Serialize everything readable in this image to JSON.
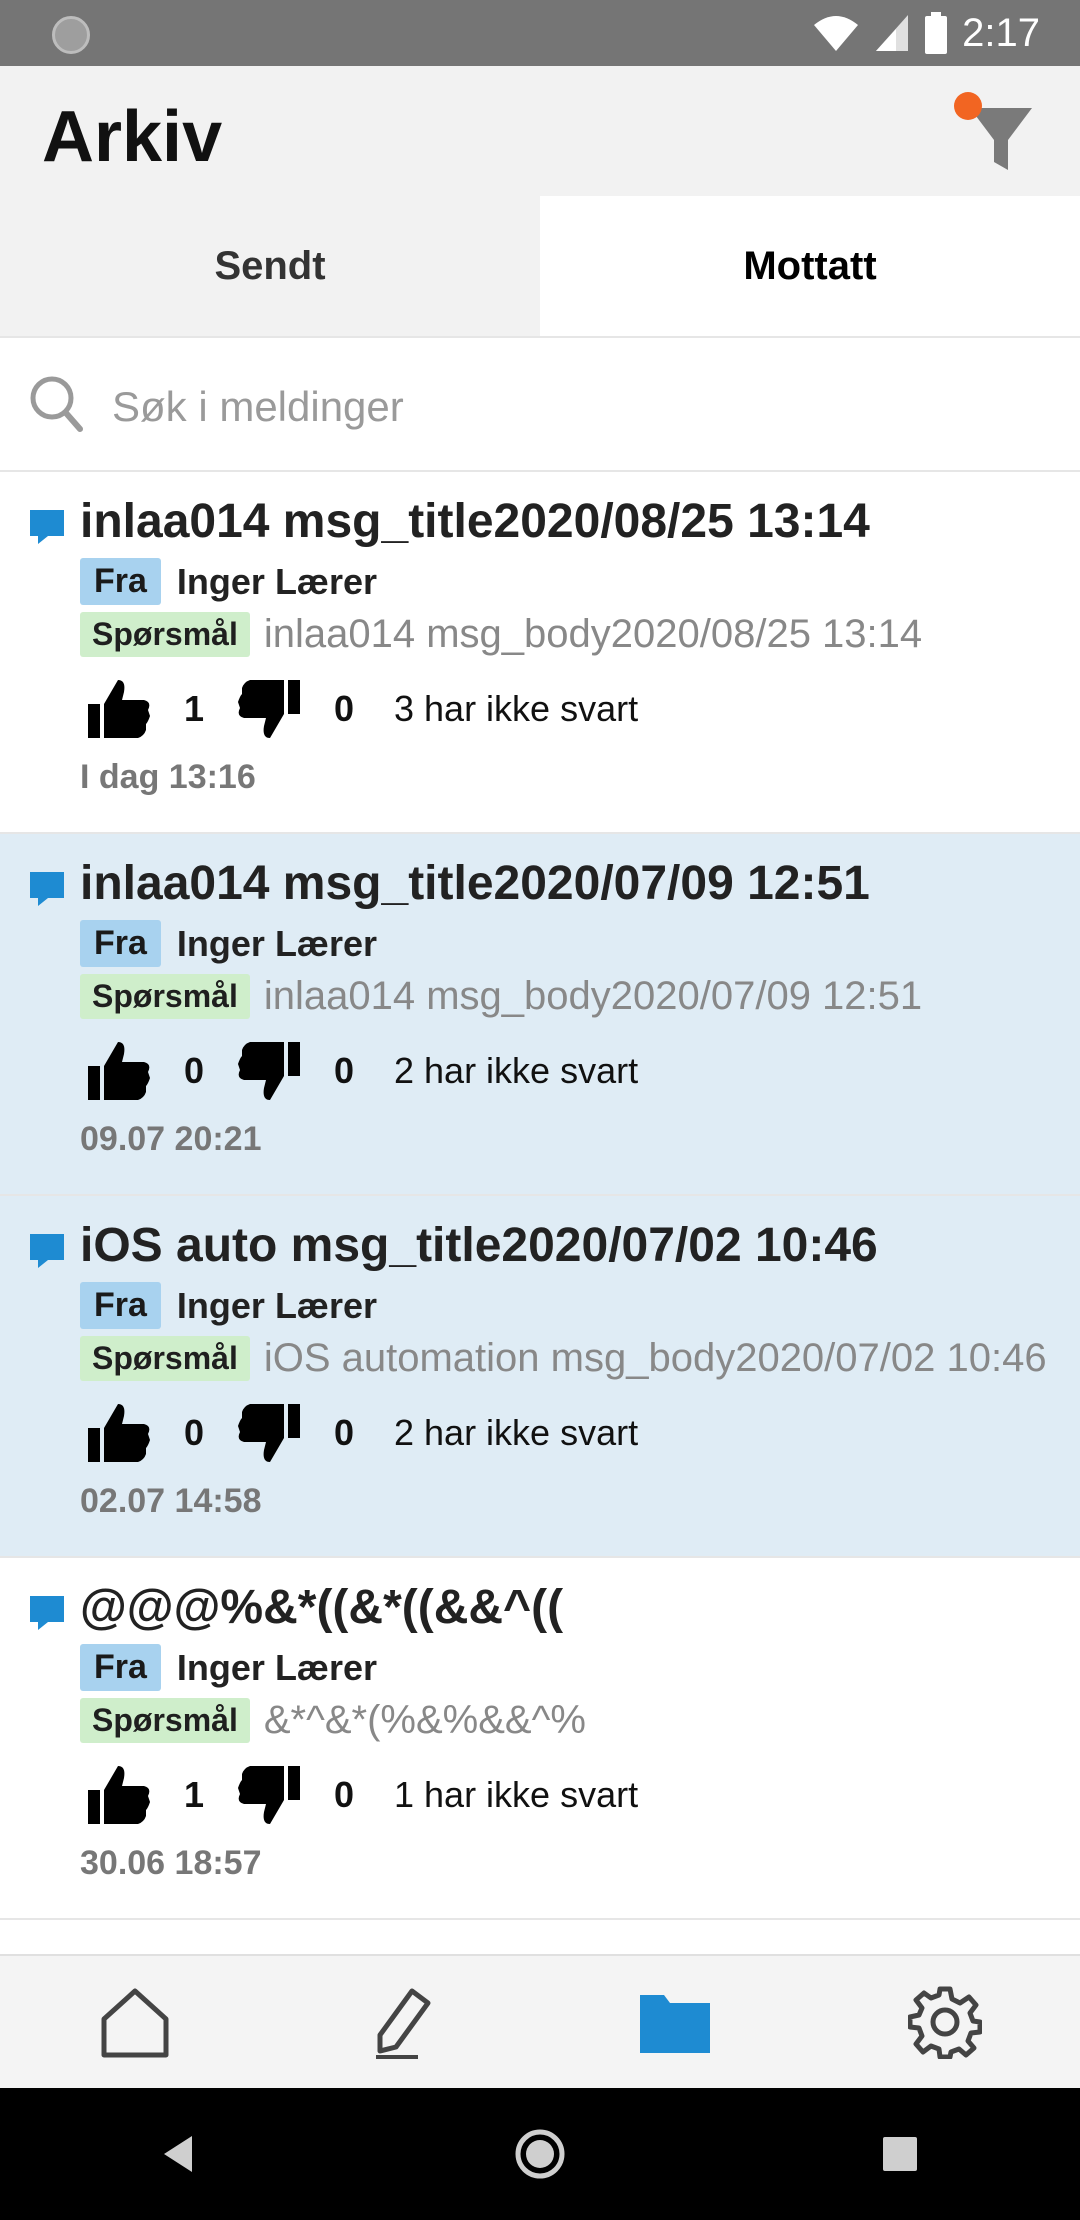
{
  "status_bar": {
    "time": "2:17"
  },
  "header": {
    "title": "Arkiv"
  },
  "tabs": [
    {
      "label": "Sendt",
      "active": false
    },
    {
      "label": "Mottatt",
      "active": true
    }
  ],
  "search": {
    "placeholder": "Søk i meldinger",
    "value": ""
  },
  "messages": [
    {
      "title": "inlaa014 msg_title2020/08/25 13:14",
      "from_label": "Fra",
      "sender": "Inger Lærer",
      "type_label": "Spørsmål",
      "body": "inlaa014 msg_body2020/08/25 13:14",
      "likes": "1",
      "dislikes": "0",
      "no_reply": "3 har ikke svart",
      "date": "I dag 13:16",
      "highlighted": false
    },
    {
      "title": "inlaa014 msg_title2020/07/09 12:51",
      "from_label": "Fra",
      "sender": "Inger Lærer",
      "type_label": "Spørsmål",
      "body": "inlaa014 msg_body2020/07/09 12:51",
      "likes": "0",
      "dislikes": "0",
      "no_reply": "2 har ikke svart",
      "date": "09.07 20:21",
      "highlighted": true
    },
    {
      "title": "iOS auto msg_title2020/07/02 10:46",
      "from_label": "Fra",
      "sender": "Inger Lærer",
      "type_label": "Spørsmål",
      "body": "iOS automation msg_body2020/07/02 10:46",
      "likes": "0",
      "dislikes": "0",
      "no_reply": "2 har ikke svart",
      "date": "02.07 14:58",
      "highlighted": true
    },
    {
      "title": "@@@%&*((&*((&&^((",
      "from_label": "Fra",
      "sender": "Inger Lærer",
      "type_label": "Spørsmål",
      "body": "&*^&*(%&%&&^%",
      "likes": "1",
      "dislikes": "0",
      "no_reply": "1 har ikke svart",
      "date": "30.06 18:57",
      "highlighted": false
    }
  ],
  "bottom_nav": [
    {
      "icon": "home-icon",
      "active": false
    },
    {
      "icon": "pen-icon",
      "active": false
    },
    {
      "icon": "folder-icon",
      "active": true
    },
    {
      "icon": "gear-icon",
      "active": false
    }
  ],
  "colors": {
    "accent": "#1e8bd2",
    "filter_dot": "#f26522",
    "highlight_row": "#dfecf5",
    "badge_fra": "#a8d2ef",
    "badge_question": "#cfeecb"
  }
}
